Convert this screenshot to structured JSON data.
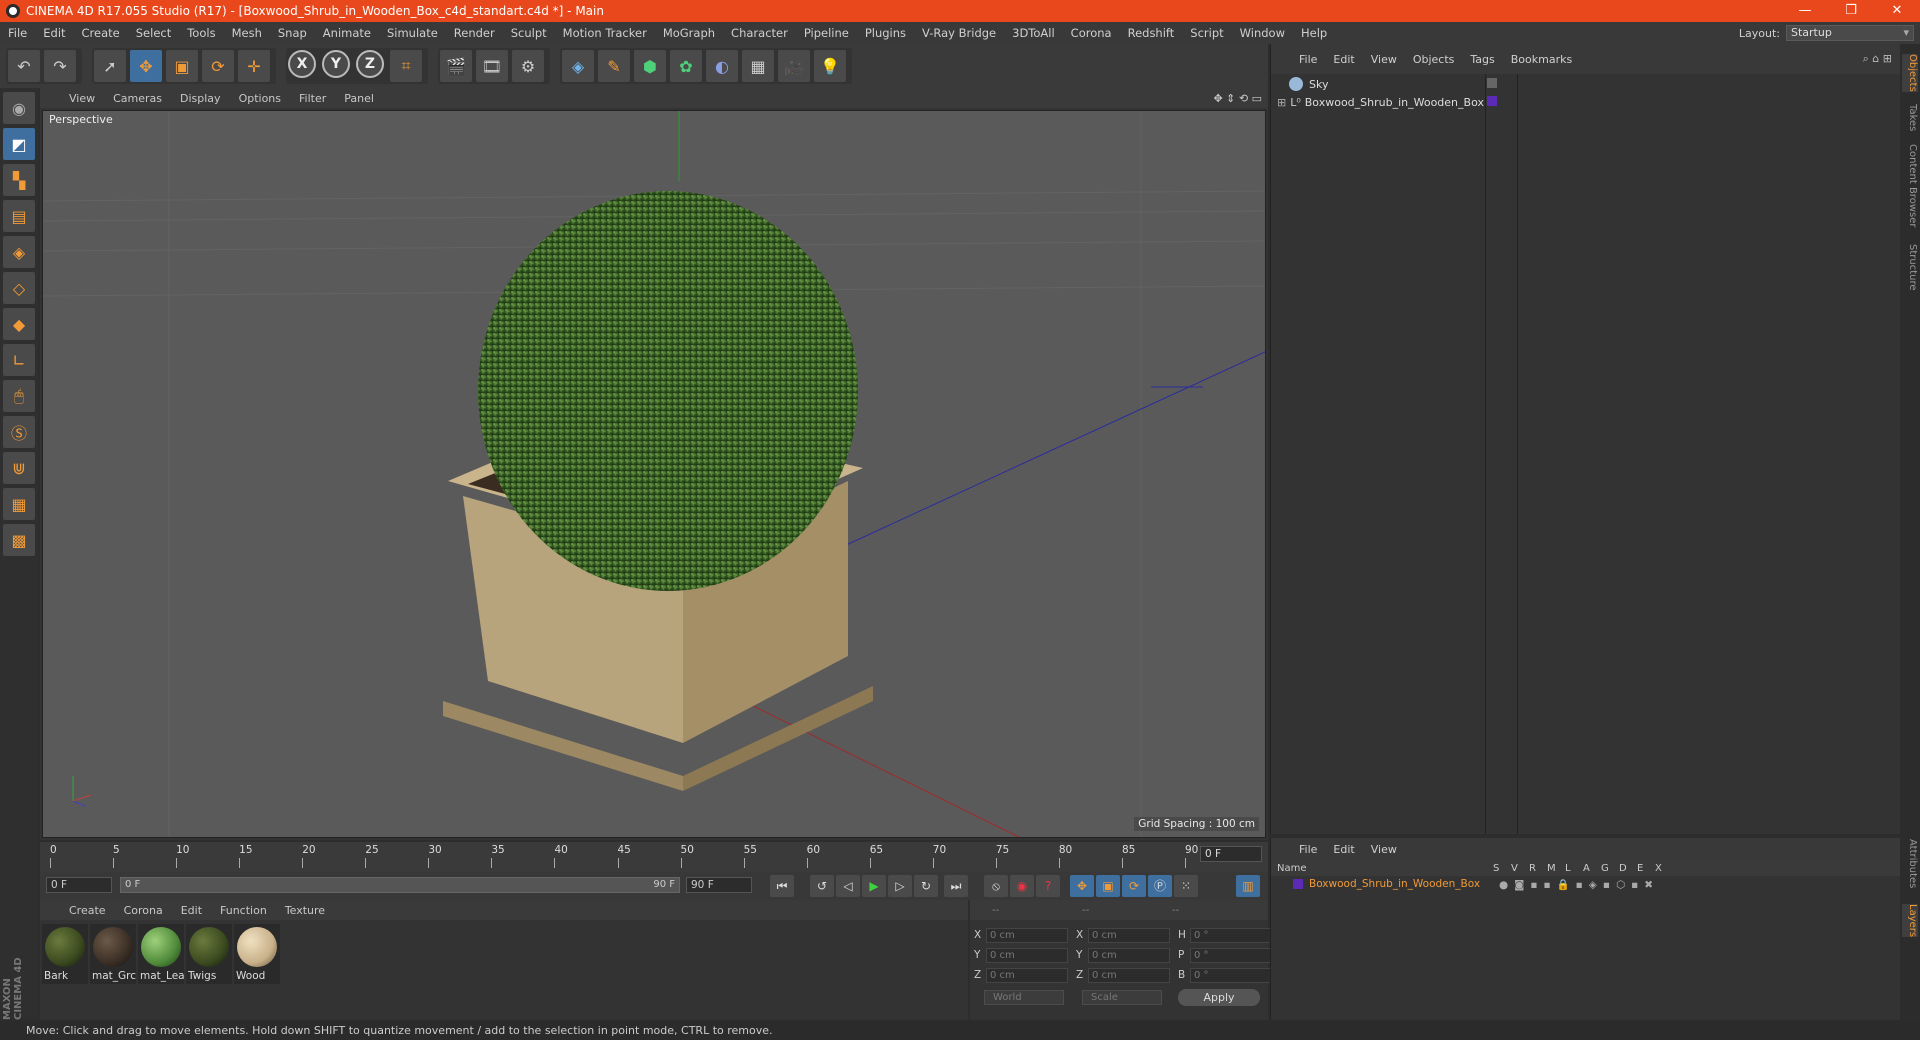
{
  "window": {
    "title": "CINEMA 4D R17.055 Studio (R17) - [Boxwood_Shrub_in_Wooden_Box_c4d_standart.c4d *] - Main",
    "controls": [
      "—",
      "❐",
      "✕"
    ]
  },
  "menu": [
    "File",
    "Edit",
    "Create",
    "Select",
    "Tools",
    "Mesh",
    "Snap",
    "Animate",
    "Simulate",
    "Render",
    "Sculpt",
    "Motion Tracker",
    "MoGraph",
    "Character",
    "Pipeline",
    "Plugins",
    "V-Ray Bridge",
    "3DToAll",
    "Corona",
    "Redshift",
    "Script",
    "Window",
    "Help"
  ],
  "layout": {
    "label": "Layout:",
    "value": "Startup"
  },
  "viewport": {
    "menu": [
      "View",
      "Cameras",
      "Display",
      "Options",
      "Filter",
      "Panel"
    ],
    "label": "Perspective",
    "grid_spacing": "Grid Spacing : 100 cm"
  },
  "timeline": {
    "ticks": [
      "0",
      "5",
      "10",
      "15",
      "20",
      "25",
      "30",
      "35",
      "40",
      "45",
      "50",
      "55",
      "60",
      "65",
      "70",
      "75",
      "80",
      "85",
      "90"
    ],
    "current": "0 F"
  },
  "transport": {
    "start": "0 F",
    "slider_left": "0 F",
    "slider_right": "90 F",
    "end": "90 F"
  },
  "materials": {
    "menu": [
      "Create",
      "Corona",
      "Edit",
      "Function",
      "Texture"
    ],
    "items": [
      {
        "label": "Bark",
        "color": "#3a4a1e"
      },
      {
        "label": "mat_Grc",
        "color": "#3b2e24"
      },
      {
        "label": "mat_Lea",
        "color": "#4f8a3a"
      },
      {
        "label": "Twigs",
        "color": "#3a4a1e"
      },
      {
        "label": "Wood",
        "color": "#c8b08a"
      }
    ]
  },
  "coords": {
    "headers": [
      "--",
      "--",
      "--"
    ],
    "rows": [
      {
        "a": "X",
        "av": "0 cm",
        "b": "X",
        "bv": "0 cm",
        "c": "H",
        "cv": "0 °"
      },
      {
        "a": "Y",
        "av": "0 cm",
        "b": "Y",
        "bv": "0 cm",
        "c": "P",
        "cv": "0 °"
      },
      {
        "a": "Z",
        "av": "0 cm",
        "b": "Z",
        "bv": "0 cm",
        "c": "B",
        "cv": "0 °"
      }
    ],
    "world": "World",
    "scale": "Scale",
    "apply": "Apply"
  },
  "objects": {
    "menu": [
      "File",
      "Edit",
      "View",
      "Objects",
      "Tags",
      "Bookmarks"
    ],
    "items": [
      "Sky",
      "Boxwood_Shrub_in_Wooden_Box"
    ]
  },
  "layers": {
    "menu": [
      "File",
      "Edit",
      "View"
    ],
    "name_header": "Name",
    "columns": [
      "S",
      "V",
      "R",
      "M",
      "L",
      "A",
      "G",
      "D",
      "E",
      "X"
    ],
    "row": "Boxwood_Shrub_in_Wooden_Box"
  },
  "side_tabs": [
    "Objects",
    "Takes",
    "Content Browser",
    "Structure",
    "Attributes",
    "Layers"
  ],
  "status": "Move: Click and drag to move elements. Hold down SHIFT to quantize movement / add to the selection in point mode, CTRL to remove.",
  "brand": "MAXON CINEMA 4D",
  "colors": {
    "accent": "#f19a38",
    "titlebar": "#e8481c",
    "selected": "#3f6f9e",
    "layer_color": "#5b2bb5"
  }
}
